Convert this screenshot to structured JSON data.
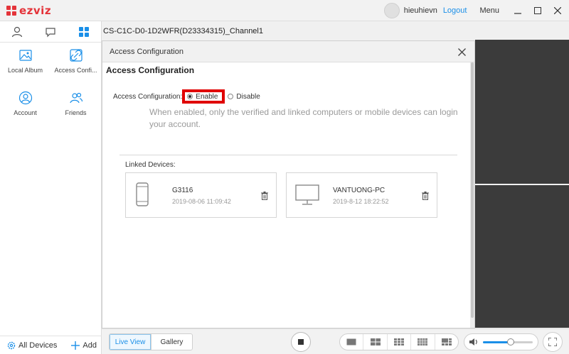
{
  "app": {
    "logo_text": "ezviz"
  },
  "header": {
    "username": "hieuhievn",
    "logout_label": "Logout",
    "menu_label": "Menu"
  },
  "sidebar": {
    "items": [
      {
        "label": "Local Album",
        "icon": "image-icon"
      },
      {
        "label": "Access Confi...",
        "icon": "link-icon"
      },
      {
        "label": "Account",
        "icon": "account-icon"
      },
      {
        "label": "Friends",
        "icon": "friends-icon"
      }
    ],
    "all_devices_label": "All Devices",
    "add_label": "Add"
  },
  "main": {
    "channel_title": "CS-C1C-D0-1D2WFR(D23334315)_Channel1"
  },
  "dialog": {
    "title": "Access Configuration",
    "section_title": "Access Configuration",
    "config_label": "Access Configuration:",
    "enable_label": "Enable",
    "disable_label": "Disable",
    "selected": "Enable",
    "hint": "When enabled, only the verified and linked computers or mobile devices can login your account.",
    "linked_devices_label": "Linked Devices:",
    "devices": [
      {
        "name": "G3116",
        "date": "2019-08-06 11:09:42",
        "icon": "phone-icon"
      },
      {
        "name": "VANTUONG-PC",
        "date": "2019-8-12 18:22:52",
        "icon": "monitor-icon"
      }
    ]
  },
  "bottombar": {
    "live_view_label": "Live View",
    "gallery_label": "Gallery",
    "volume_level": 0.55
  },
  "colors": {
    "accent": "#1a8fe8",
    "brand": "#e4343a",
    "highlight": "#e00000"
  }
}
